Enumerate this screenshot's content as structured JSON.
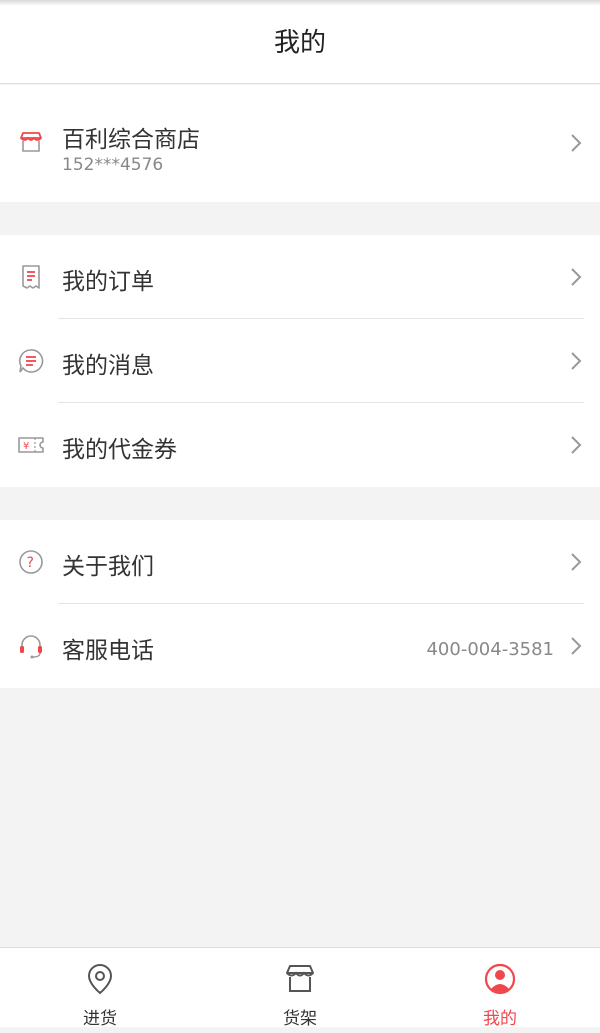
{
  "header": {
    "title": "我的"
  },
  "shop": {
    "name": "百利综合商店",
    "phone": "152***4576"
  },
  "menu_group1": [
    {
      "label": "我的订单",
      "icon": "receipt-icon"
    },
    {
      "label": "我的消息",
      "icon": "message-icon"
    },
    {
      "label": "我的代金券",
      "icon": "coupon-icon"
    }
  ],
  "menu_group2": [
    {
      "label": "关于我们",
      "icon": "question-icon"
    },
    {
      "label": "客服电话",
      "icon": "headset-icon",
      "value": "400-004-3581"
    }
  ],
  "tabs": [
    {
      "label": "进货",
      "icon": "location-pin-icon"
    },
    {
      "label": "货架",
      "icon": "shop-icon"
    },
    {
      "label": "我的",
      "icon": "user-icon",
      "active": true
    }
  ],
  "colors": {
    "accent": "#f0474d",
    "background": "#f3f3f3"
  }
}
